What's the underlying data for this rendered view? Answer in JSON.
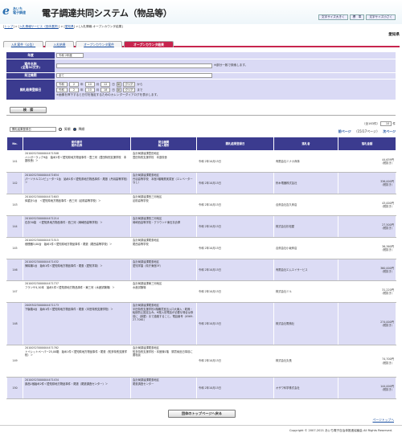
{
  "header": {
    "logo_mark": "e",
    "logo_line1": "あいち",
    "logo_line2": "電子調達",
    "title": "電子調達共同システム（物品等）",
    "buttons": [
      "文字サイズ大きく",
      "標　準",
      "文字サイズ小さく"
    ]
  },
  "breadcrumb": [
    "トップ",
    "入札情報サービス（団体選択）",
    "愛知県",
    "入札情報-オープンカウンタ結果"
  ],
  "prefecture": "愛知県",
  "tabs": [
    "入札案件（公告）",
    "入札結果",
    "オープンカウンタ案件",
    "オープンカウンタ結果"
  ],
  "form": {
    "nendo_label": "年度",
    "nendo_value": "令和 2年度",
    "anken_label": "案件名称\n(全角50文字)",
    "anken_note": "※部分一致で検索します。",
    "hatchu_label": "発注機関",
    "hatchu_value": "全て",
    "date_label": "開札結果登録日",
    "from": {
      "era": "令和",
      "y": "2",
      "m": "10",
      "d": "12",
      "sep1": "年",
      "sep2": "月",
      "sep3": "日",
      "to_word": "から"
    },
    "to": {
      "era": "令和",
      "y": "2",
      "m": "10",
      "d": "18",
      "sep1": "年",
      "sep2": "月",
      "sep3": "日",
      "to_word": "まで"
    },
    "cal_label": "曜",
    "clear_label": "クリア",
    "date_note": "※画像を押下すると日付を指定するためのカレンダーダイアログを表示します。",
    "search_button": "検　索"
  },
  "controls": {
    "sort_value": "開札結果登録日",
    "radio1": "昇順",
    "radio2": "降順"
  },
  "pager": {
    "total": "（全163件）",
    "per_page": "10",
    "per_page_suffix": "件",
    "page_info": "（15/17ページ）",
    "next": "次ページ",
    "prev": "前ページ"
  },
  "table": {
    "headers": [
      "No.",
      "案件番号\n案件名称",
      "発注機関\n納入場所",
      "開札結果登録日",
      "落札者",
      "落札金額"
    ],
    "rows": [
      {
        "no": "141",
        "num": "20100523000004471508",
        "name": "ハンガーラック9台　始め1件＜愛知県地方物品事件・豊三河（豊田特別支援学校　本庭校舎）＞",
        "org": "会計局調達課豊田地区",
        "place": "豊田特別支援学校　本庭校舎",
        "date": "令和 2年10月15日",
        "winner": "有限会社ミナカ商事",
        "amount": "44,639円",
        "tax": "（税抜き）"
      },
      {
        "no": "142",
        "num": "20100523000004471654",
        "name": "パーソナルコンピューター1台　始め1件＜愛知県地方物品事件・尾張（丹羽高等学校）＞",
        "org": "会計局調達課尾張地区",
        "place": "丹羽高等学校　本館3階職業実習室（エレベーターなし）",
        "date": "令和 2年10月15日",
        "winner": "鈴木電器株式会社",
        "amount": "336,000円",
        "tax": "（税抜き）"
      },
      {
        "no": "143",
        "num": "20100523000004471603",
        "name": "体重計1台　＜愛知県地方物品事件・西三河（足助高等学校）＞",
        "org": "会計局調達課西三河地区",
        "place": "足助高等学校",
        "date": "令和 2年10月15日",
        "winner": "合資会社吉久商店",
        "amount": "43,000円",
        "tax": "（税抜き）"
      },
      {
        "no": "144",
        "num": "20100523000004471214",
        "name": "石灰50袋　＜愛知県地方物品事件・西三河（岡崎西高等学校）＞",
        "org": "会計局調達課西三河地区",
        "place": "岡崎西高等学校・グラウンド東石灰倉庫",
        "date": "令和 2年10月15日",
        "winner": "株式会社杉松屋",
        "amount": "27,500円",
        "tax": "（税抜き）"
      },
      {
        "no": "145",
        "num": "20100523000004471515",
        "name": "燻煙器3,00台　始め1件＜愛知県地方物品事件・尾張（尾西高等学校）＞",
        "org": "会計局調達課尾張地区",
        "place": "尾西高等学校",
        "date": "令和 2年10月15日",
        "winner": "合資会社小坂商店",
        "amount": "36,360円",
        "tax": "（税抜き）"
      },
      {
        "no": "146",
        "num": "20100523000004471432",
        "name": "掃除機1台　始め1件＜愛知県地方物品事件・尾張（愛知学泉）＞",
        "org": "会計局調達課尾張地区",
        "place": "愛知学園（県庁東館3F）",
        "date": "令和 2年10月15日",
        "winner": "有限会社エムエイサービス",
        "amount": "360,000円",
        "tax": "（税抜き）"
      },
      {
        "no": "147",
        "num": "20100523000004471737",
        "name": "フランゲ4,10本　始め1件＜愛知県地方物品事件・東三河（水産試験場）＞",
        "org": "会計局調達課東三河地区",
        "place": "水産試験場",
        "date": "令和 2年10月15日",
        "winner": "株式会社ミル",
        "amount": "31,220円",
        "tax": "（税抜き）"
      },
      {
        "no": "148",
        "num": "20093023000004471173",
        "name": "下駄箱4台　始め1件＜愛知県地方物品事件・尾張（半田特別支援学校）＞",
        "org": "会計局調達課尾張地区",
        "place": "半田特別支援学校1階職員室出入口大扉入・乾燥・転倒防止固定込み。※搬入前電話が必要な場合は事前に（鉢屋）まで連絡すること。電話番号（0569-27-7061）",
        "date": "令和 2年10月15日",
        "winner": "株式会社電積社",
        "amount": "274,000円",
        "tax": "（税抜き）"
      },
      {
        "no": "149",
        "num": "20100523000004471762",
        "name": "トイレットペーパー25,00箱　始め1件＜愛知県地方物品事件・尾張（知多特別支援学校）＞",
        "org": "会計局調達課尾張地区",
        "place": "知多特別支援学校・本館棟1階　購買納品日事前に要相談",
        "date": "令和 2年10月15日",
        "winner": "株式会社丸長",
        "amount": "74,700円",
        "tax": "（税抜き）"
      },
      {
        "no": "150",
        "num": "20100523000004471434",
        "name": "部品1個始め2件＜愛知県地方物品事件・尾張（尾張調査センター）＞",
        "org": "会計局調達課尾張地区",
        "place": "尾張調査センター",
        "date": "令和 2年10月15日",
        "winner": "オザワ科学株式会社　　",
        "amount": "144,000円",
        "tax": "（税抜き）"
      }
    ]
  },
  "back_button": "団体のトップページへ戻る",
  "page_top": "ページトップへ",
  "footer": "Copyright © 2007-2021 あいち電子自治体推進協議会 All Rights Reserved."
}
